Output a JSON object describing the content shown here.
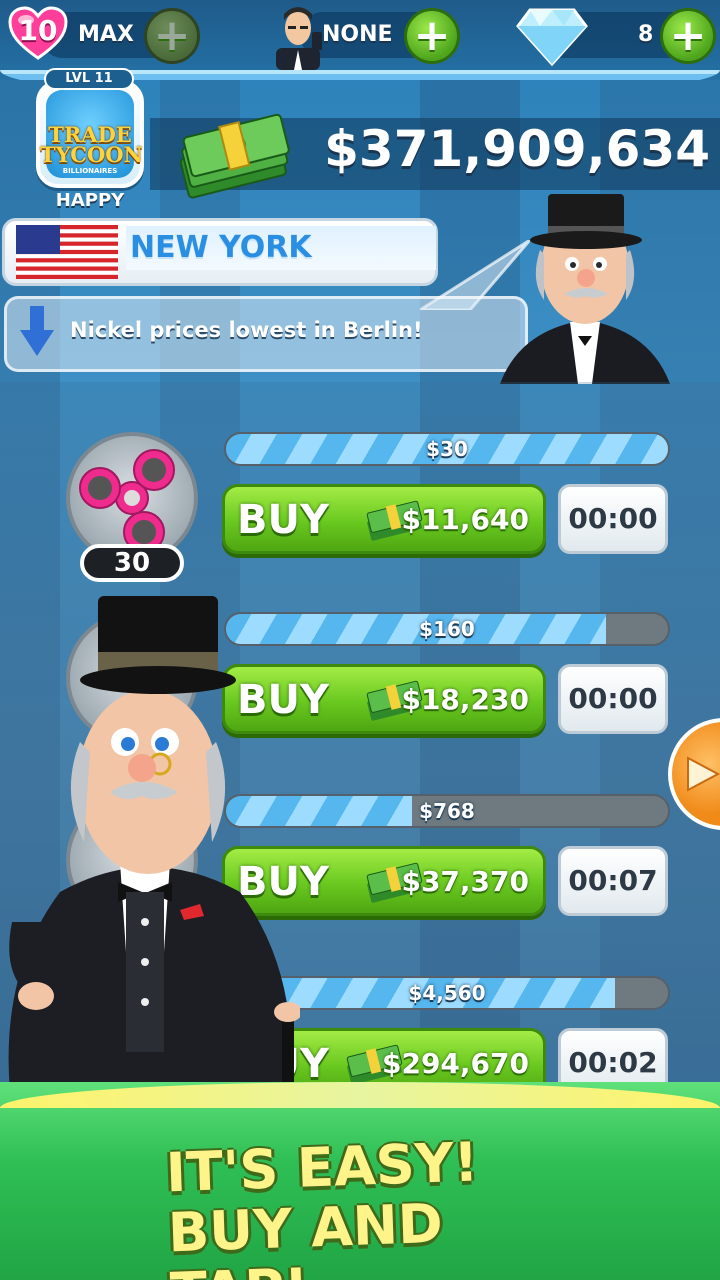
{
  "hud": {
    "lives": "10",
    "lives_status": "MAX",
    "manager_status": "NONE",
    "gems": "8"
  },
  "profile": {
    "level": "LVL 11",
    "logo_line1": "TRADE",
    "logo_line2": "TYCOON",
    "logo_sub": "BILLIONAIRES",
    "mood": "HAPPY"
  },
  "balance": "$371,909,634",
  "location": {
    "city": "NEW YORK"
  },
  "news": "Nickel prices lowest in Berlin!",
  "items": [
    {
      "name": "fidget-spinner",
      "count": "30",
      "price_tag": "$30",
      "progress": 1.0,
      "buy_label": "BUY",
      "price": "$11,640",
      "timer": "00:00"
    },
    {
      "name": "item-2",
      "count": "",
      "price_tag": "$160",
      "progress": 0.86,
      "buy_label": "BUY",
      "price": "$18,230",
      "timer": "00:00"
    },
    {
      "name": "item-3",
      "count": "",
      "price_tag": "$768",
      "progress": 0.42,
      "buy_label": "BUY",
      "price": "$37,370",
      "timer": "00:07"
    },
    {
      "name": "item-4",
      "count": "",
      "price_tag": "$4,560",
      "progress": 0.88,
      "buy_label": "BUY",
      "price": "$294,670",
      "timer": "00:02"
    }
  ],
  "promo": {
    "line1": "IT'S EASY!",
    "line2": "BUY AND TAP!"
  },
  "colors": {
    "accent_green": "#69c81f",
    "sky_blue": "#2a7fb8",
    "promo_yellow": "#fff48a"
  }
}
